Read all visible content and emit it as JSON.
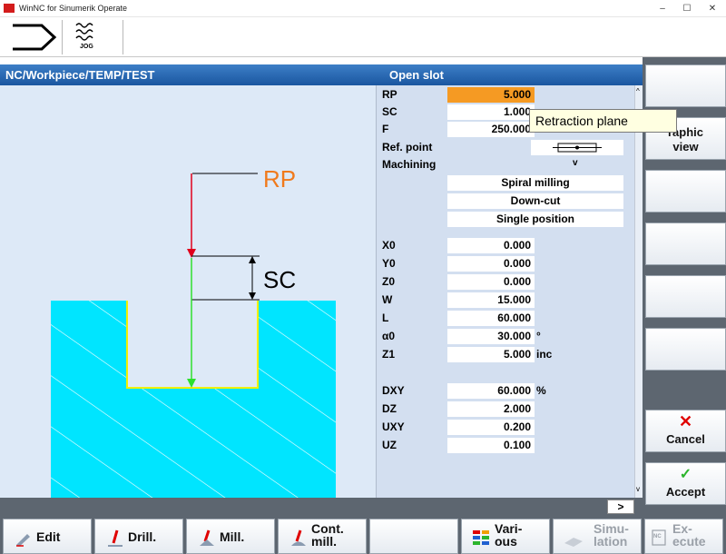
{
  "window": {
    "title": "WinNC for Sinumerik Operate",
    "minimize": "–",
    "maximize": "☐",
    "close": "✕"
  },
  "toolbar": {
    "mode_label": "JOG"
  },
  "header": {
    "path": "NC/Workpiece/TEMP/TEST",
    "cycle_title": "Open slot"
  },
  "graphic": {
    "rp_label": "RP",
    "sc_label": "SC"
  },
  "tooltip": "Retraction plane",
  "params": {
    "rp": {
      "label": "RP",
      "value": "5.000"
    },
    "sc": {
      "label": "SC",
      "value": "1.000"
    },
    "f": {
      "label": "F",
      "value": "250.000"
    },
    "ref_point": {
      "label": "Ref. point"
    },
    "machining": {
      "label": "Machining",
      "value": "v"
    },
    "strategy": "Spiral milling",
    "direction": "Down-cut",
    "position": "Single position",
    "x0": {
      "label": "X0",
      "value": "0.000"
    },
    "y0": {
      "label": "Y0",
      "value": "0.000"
    },
    "z0": {
      "label": "Z0",
      "value": "0.000"
    },
    "w": {
      "label": "W",
      "value": "15.000"
    },
    "l": {
      "label": "L",
      "value": "60.000"
    },
    "a0": {
      "label": "α0",
      "value": "30.000",
      "unit": "°"
    },
    "z1": {
      "label": "Z1",
      "value": "5.000",
      "unit": "inc"
    },
    "dxy": {
      "label": "DXY",
      "value": "60.000",
      "unit": "%"
    },
    "dz": {
      "label": "DZ",
      "value": "2.000"
    },
    "uxy": {
      "label": "UXY",
      "value": "0.200"
    },
    "uz": {
      "label": "UZ",
      "value": "0.100"
    }
  },
  "status": {
    "goto": ">"
  },
  "right_softkeys": {
    "graphic_view_1": "raphic",
    "graphic_view_2": "view",
    "cancel": "Cancel",
    "accept": "Accept"
  },
  "bottom_softkeys": {
    "edit": "Edit",
    "drill": "Drill.",
    "mill": "Mill.",
    "cont_mill_1": "Cont.",
    "cont_mill_2": "mill.",
    "various_1": "Vari-",
    "various_2": "ous",
    "simulation_1": "Simu-",
    "simulation_2": "lation",
    "execute_1": "Ex-",
    "execute_2": "ecute"
  },
  "colors": {
    "header_blue": "#1a56a0",
    "selected_field": "#f59a23",
    "workpiece": "#00e5ff",
    "softkey_bar": "#5d6670"
  }
}
